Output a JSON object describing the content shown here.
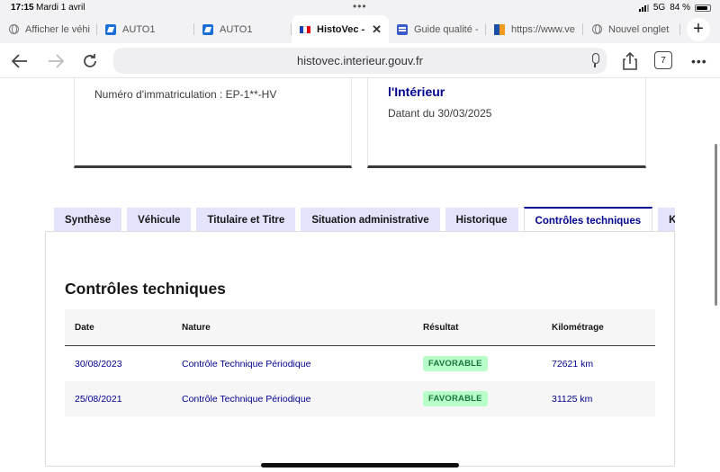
{
  "status": {
    "time": "17:15",
    "date": "Mardi 1 avril",
    "network": "5G",
    "battery": "84 %"
  },
  "tabs": [
    {
      "label": "Afficher le véhi",
      "icon": "globe-icon"
    },
    {
      "label": "AUTO1",
      "icon": "auto1-icon"
    },
    {
      "label": "AUTO1",
      "icon": "auto1-icon"
    },
    {
      "label": "HistoVec -",
      "icon": "french-flag-icon",
      "active": true
    },
    {
      "label": "Guide qualité -",
      "icon": "guide-icon"
    },
    {
      "label": "https://www.ve",
      "icon": "site-icon"
    },
    {
      "label": "Nouvel onglet",
      "icon": "globe-icon"
    }
  ],
  "toolbar": {
    "url": "histovec.interieur.gouv.fr",
    "tab_count": "7"
  },
  "cards": {
    "registration": "Numéro d'immatriculation : EP-1**-HV",
    "org": "l'Intérieur",
    "date": "Datant du 30/03/2025"
  },
  "page_tabs": [
    {
      "label": "Synthèse"
    },
    {
      "label": "Véhicule"
    },
    {
      "label": "Titulaire et Titre"
    },
    {
      "label": "Situation administrative"
    },
    {
      "label": "Historique"
    },
    {
      "label": "Contrôles techniques",
      "active": true
    },
    {
      "label": "Kilo"
    }
  ],
  "section": {
    "title": "Contrôles techniques",
    "headers": [
      "Date",
      "Nature",
      "Résultat",
      "Kilométrage"
    ],
    "rows": [
      {
        "date": "30/08/2023",
        "nature": "Contrôle Technique Périodique",
        "result": "FAVORABLE",
        "km": "72621 km"
      },
      {
        "date": "25/08/2021",
        "nature": "Contrôle Technique Périodique",
        "result": "FAVORABLE",
        "km": "31125 km"
      }
    ]
  },
  "colors": {
    "accent": "#000091",
    "tab_bg": "#e3e3fd",
    "badge_bg": "#b8fec9",
    "badge_text": "#18753c"
  }
}
